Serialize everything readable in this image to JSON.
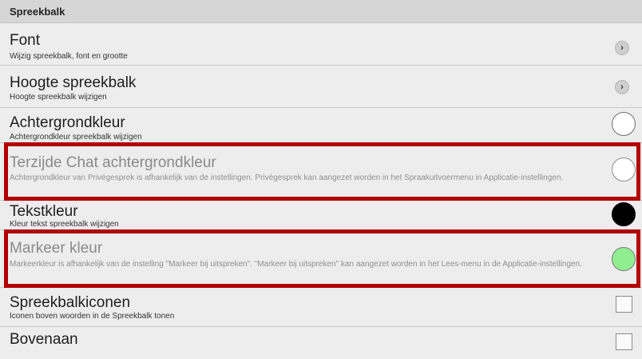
{
  "header": {
    "title": "Spreekbalk"
  },
  "settings": [
    {
      "title": "Font",
      "desc": "Wijzig spreekbalk, font en grootte",
      "control": "chevron-right-icon"
    },
    {
      "title": "Hoogte spreekbalk",
      "desc": "Hoogte spreekbalk wijzigen",
      "control": "chevron-right-icon"
    },
    {
      "title": "Achtergrondkleur",
      "desc": "Achtergrondkleur spreekbalk wijzigen",
      "control": "color-swatch",
      "color": "#ffffff"
    },
    {
      "title": "Terzijde Chat achtergrondkleur",
      "desc": "Achtergrondkleur van Privégesprek is afhankelijk van de instellingen. Privégesprek kan aangezet worden in het Spraakuitvoermenu in Applicatie-instellingen.",
      "control": "color-swatch",
      "color": "#ffffff",
      "disabled": true
    },
    {
      "title": "Tekstkleur",
      "desc": "Kleur tekst spreekbalk wijzigen",
      "control": "color-swatch",
      "color": "#000000"
    },
    {
      "title": "Markeer kleur",
      "desc": "Markeerkleur is afhankelijk van de instelling \"Markeer bij uitspreken\". \"Markeer bij uitspreken\" kan aangezet worden in het Lees-menu in de Applicatie-instellingen.",
      "control": "color-swatch",
      "color": "#90ee90",
      "disabled": true
    },
    {
      "title": "Spreekbalkiconen",
      "desc": "Iconen boven woorden in de Spreekbalk tonen",
      "control": "checkbox",
      "checked": false
    },
    {
      "title": "Bovenaan",
      "desc": "",
      "control": "checkbox",
      "checked": false
    }
  ],
  "highlight_color": "#b20000"
}
